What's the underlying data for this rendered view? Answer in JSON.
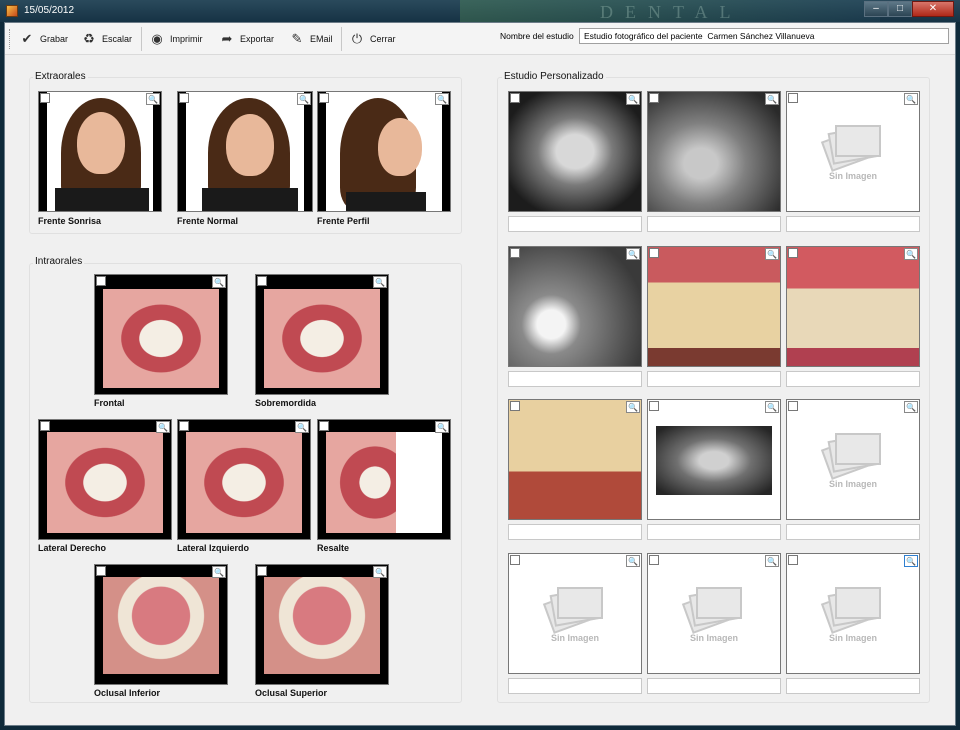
{
  "window": {
    "title": "15/05/2012",
    "deco_text": "DENTAL"
  },
  "toolbar": {
    "items": [
      {
        "label": "Grabar",
        "icon": "check-icon"
      },
      {
        "label": "Escalar",
        "icon": "recycle-icon"
      },
      {
        "label": "Imprimir",
        "icon": "eye-icon"
      },
      {
        "label": "Exportar",
        "icon": "export-icon"
      },
      {
        "label": "EMail",
        "icon": "pen-icon"
      },
      {
        "label": "Cerrar",
        "icon": "power-icon"
      }
    ],
    "study_name_label": "Nombre del estudio",
    "study_name_value": "Estudio fotográfico del paciente  Carmen Sánchez Villanueva"
  },
  "extraorales": {
    "title": "Extraorales",
    "photos": [
      {
        "caption": "Frente Sonrisa"
      },
      {
        "caption": "Frente Normal"
      },
      {
        "caption": "Frente Perfil"
      }
    ]
  },
  "intraorales": {
    "title": "Intraorales",
    "photos": [
      {
        "caption": "Frontal"
      },
      {
        "caption": "Sobremordida"
      },
      {
        "caption": "Lateral Derecho"
      },
      {
        "caption": "Lateral Izquierdo"
      },
      {
        "caption": "Resalte"
      },
      {
        "caption": "Oclusal Inferior"
      },
      {
        "caption": "Oclusal Superior"
      }
    ]
  },
  "personalizado": {
    "title": "Estudio Personalizado",
    "no_image_label": "Sin Imagen"
  }
}
